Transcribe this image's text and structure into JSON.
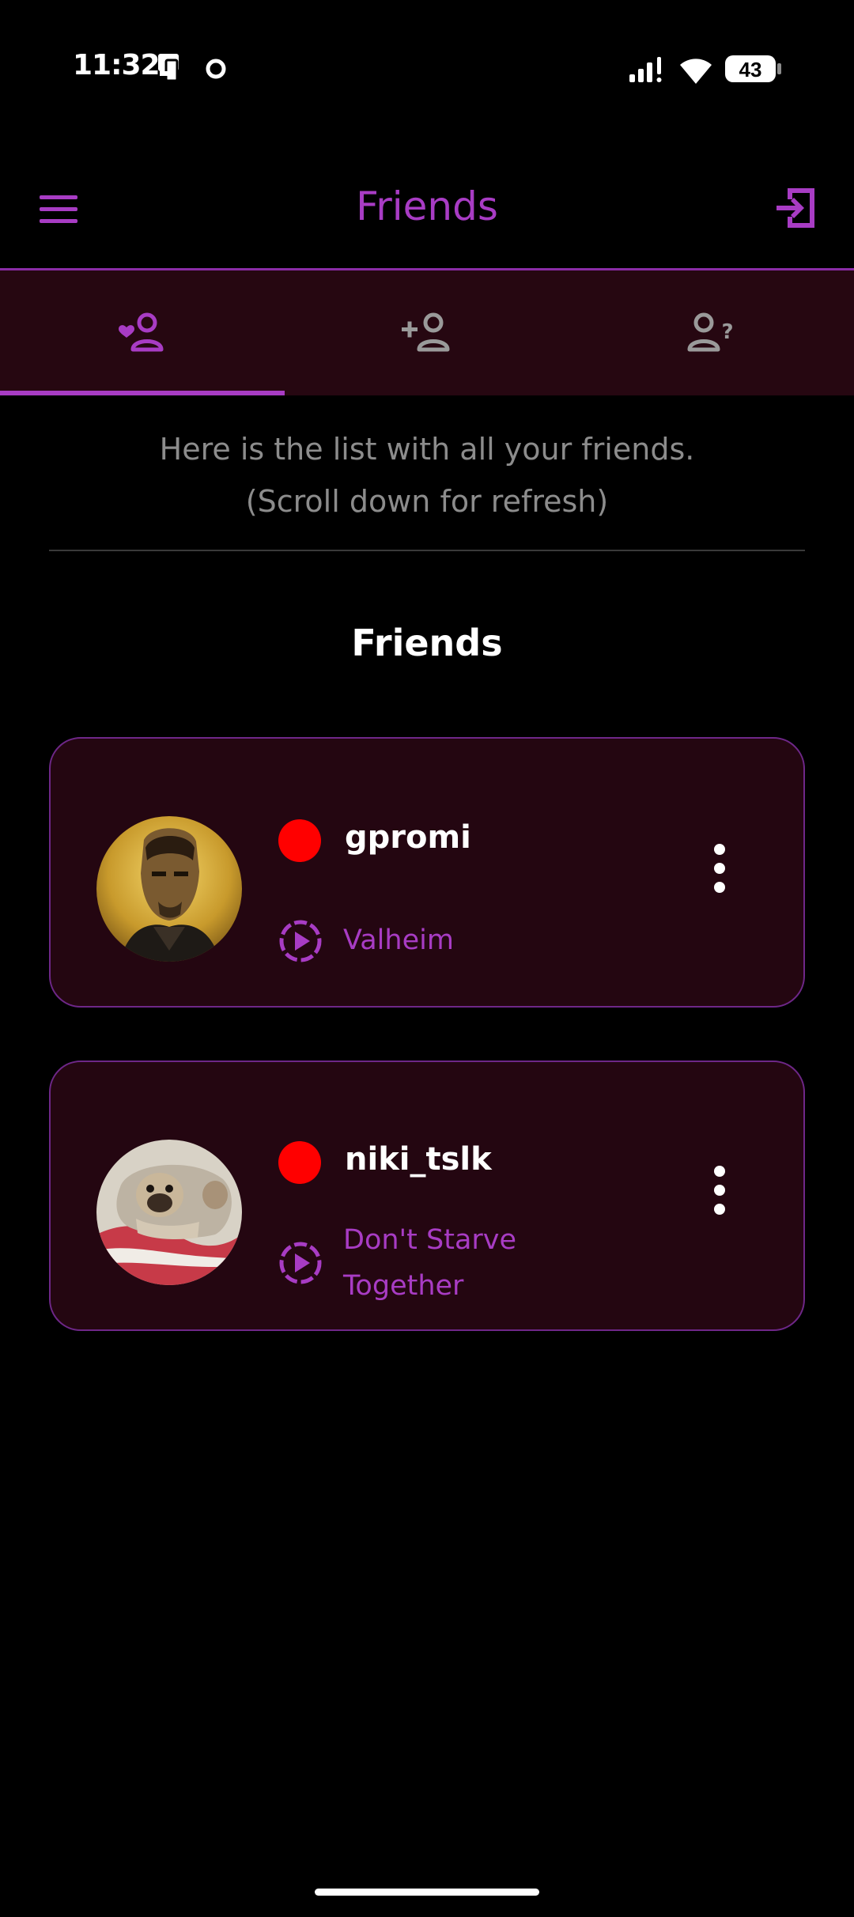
{
  "status_bar": {
    "time": "11:32",
    "battery": "43",
    "icons": [
      "device-icon",
      "circle-notification-icon",
      "signal-icon",
      "wifi-icon",
      "battery-icon"
    ]
  },
  "header": {
    "title": "Friends",
    "menu_icon": "hamburger-menu-icon",
    "logout_icon": "logout-icon"
  },
  "tabs": [
    {
      "icon": "friends-heart-icon",
      "selected": true
    },
    {
      "icon": "add-friend-icon",
      "selected": false
    },
    {
      "icon": "friend-request-icon",
      "selected": false
    }
  ],
  "info": {
    "line1": "Here is the list with all your friends.",
    "line2": "(Scroll down for refresh)"
  },
  "section_title": "Friends",
  "friends": [
    {
      "name": "gpromi",
      "status": "online",
      "game": "Valheim"
    },
    {
      "name": "niki_tslk",
      "status": "online",
      "game": "Don't Starve Together"
    }
  ],
  "colors": {
    "accent": "#a83cc4",
    "card_bg": "#240611",
    "status_dot": "#ff0000",
    "background": "#000000"
  }
}
